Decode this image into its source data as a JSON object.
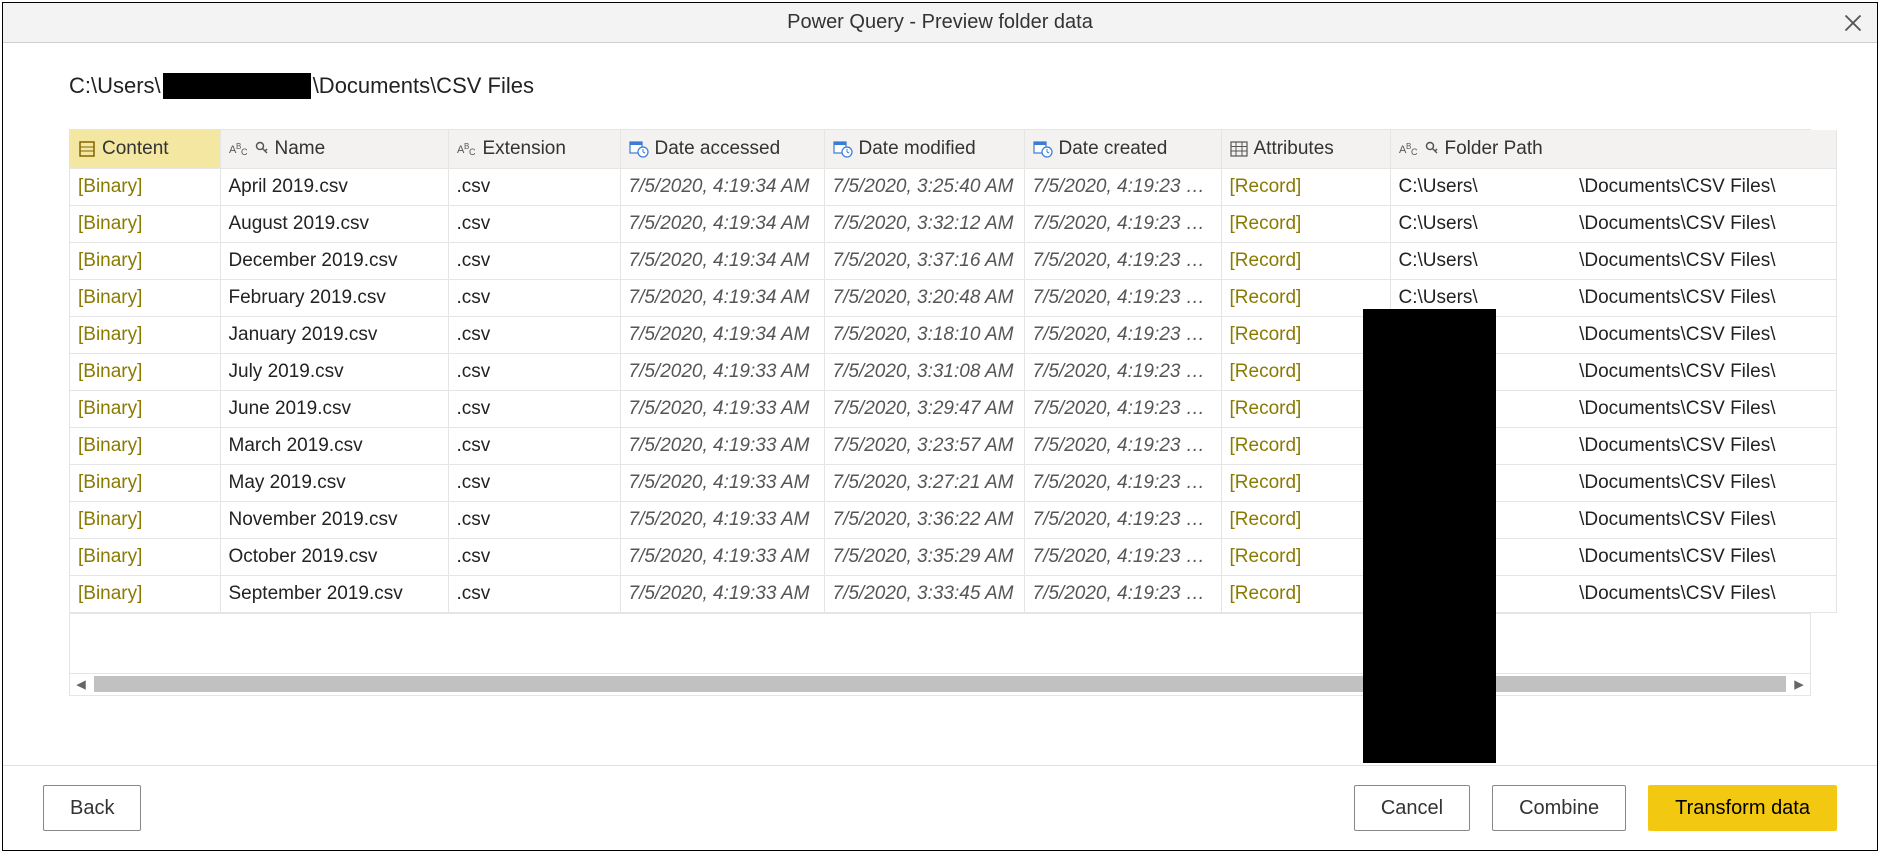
{
  "title": "Power Query - Preview folder data",
  "path_prefix": "C:\\Users\\",
  "path_suffix": "\\Documents\\CSV Files",
  "columns": {
    "content": "Content",
    "name": "Name",
    "extension": "Extension",
    "accessed": "Date accessed",
    "modified": "Date modified",
    "created": "Date created",
    "attributes": "Attributes",
    "folder": "Folder Path"
  },
  "folder_prefix": "C:\\Users\\",
  "folder_suffix": "\\Documents\\CSV Files\\",
  "rows": [
    {
      "content": "[Binary]",
      "name": "April 2019.csv",
      "ext": ".csv",
      "acc": "7/5/2020, 4:19:34 AM",
      "mod": "7/5/2020, 3:25:40 AM",
      "cre": "7/5/2020, 4:19:23 …",
      "attr": "[Record]"
    },
    {
      "content": "[Binary]",
      "name": "August 2019.csv",
      "ext": ".csv",
      "acc": "7/5/2020, 4:19:34 AM",
      "mod": "7/5/2020, 3:32:12 AM",
      "cre": "7/5/2020, 4:19:23 …",
      "attr": "[Record]"
    },
    {
      "content": "[Binary]",
      "name": "December 2019.csv",
      "ext": ".csv",
      "acc": "7/5/2020, 4:19:34 AM",
      "mod": "7/5/2020, 3:37:16 AM",
      "cre": "7/5/2020, 4:19:23 …",
      "attr": "[Record]"
    },
    {
      "content": "[Binary]",
      "name": "February 2019.csv",
      "ext": ".csv",
      "acc": "7/5/2020, 4:19:34 AM",
      "mod": "7/5/2020, 3:20:48 AM",
      "cre": "7/5/2020, 4:19:23 …",
      "attr": "[Record]"
    },
    {
      "content": "[Binary]",
      "name": "January 2019.csv",
      "ext": ".csv",
      "acc": "7/5/2020, 4:19:34 AM",
      "mod": "7/5/2020, 3:18:10 AM",
      "cre": "7/5/2020, 4:19:23 …",
      "attr": "[Record]"
    },
    {
      "content": "[Binary]",
      "name": "July 2019.csv",
      "ext": ".csv",
      "acc": "7/5/2020, 4:19:33 AM",
      "mod": "7/5/2020, 3:31:08 AM",
      "cre": "7/5/2020, 4:19:23 …",
      "attr": "[Record]"
    },
    {
      "content": "[Binary]",
      "name": "June 2019.csv",
      "ext": ".csv",
      "acc": "7/5/2020, 4:19:33 AM",
      "mod": "7/5/2020, 3:29:47 AM",
      "cre": "7/5/2020, 4:19:23 …",
      "attr": "[Record]"
    },
    {
      "content": "[Binary]",
      "name": "March 2019.csv",
      "ext": ".csv",
      "acc": "7/5/2020, 4:19:33 AM",
      "mod": "7/5/2020, 3:23:57 AM",
      "cre": "7/5/2020, 4:19:23 …",
      "attr": "[Record]"
    },
    {
      "content": "[Binary]",
      "name": "May 2019.csv",
      "ext": ".csv",
      "acc": "7/5/2020, 4:19:33 AM",
      "mod": "7/5/2020, 3:27:21 AM",
      "cre": "7/5/2020, 4:19:23 …",
      "attr": "[Record]"
    },
    {
      "content": "[Binary]",
      "name": "November 2019.csv",
      "ext": ".csv",
      "acc": "7/5/2020, 4:19:33 AM",
      "mod": "7/5/2020, 3:36:22 AM",
      "cre": "7/5/2020, 4:19:23 …",
      "attr": "[Record]"
    },
    {
      "content": "[Binary]",
      "name": "October 2019.csv",
      "ext": ".csv",
      "acc": "7/5/2020, 4:19:33 AM",
      "mod": "7/5/2020, 3:35:29 AM",
      "cre": "7/5/2020, 4:19:23 …",
      "attr": "[Record]"
    },
    {
      "content": "[Binary]",
      "name": "September 2019.csv",
      "ext": ".csv",
      "acc": "7/5/2020, 4:19:33 AM",
      "mod": "7/5/2020, 3:33:45 AM",
      "cre": "7/5/2020, 4:19:23 …",
      "attr": "[Record]"
    }
  ],
  "buttons": {
    "back": "Back",
    "cancel": "Cancel",
    "combine": "Combine",
    "transform": "Transform data"
  }
}
